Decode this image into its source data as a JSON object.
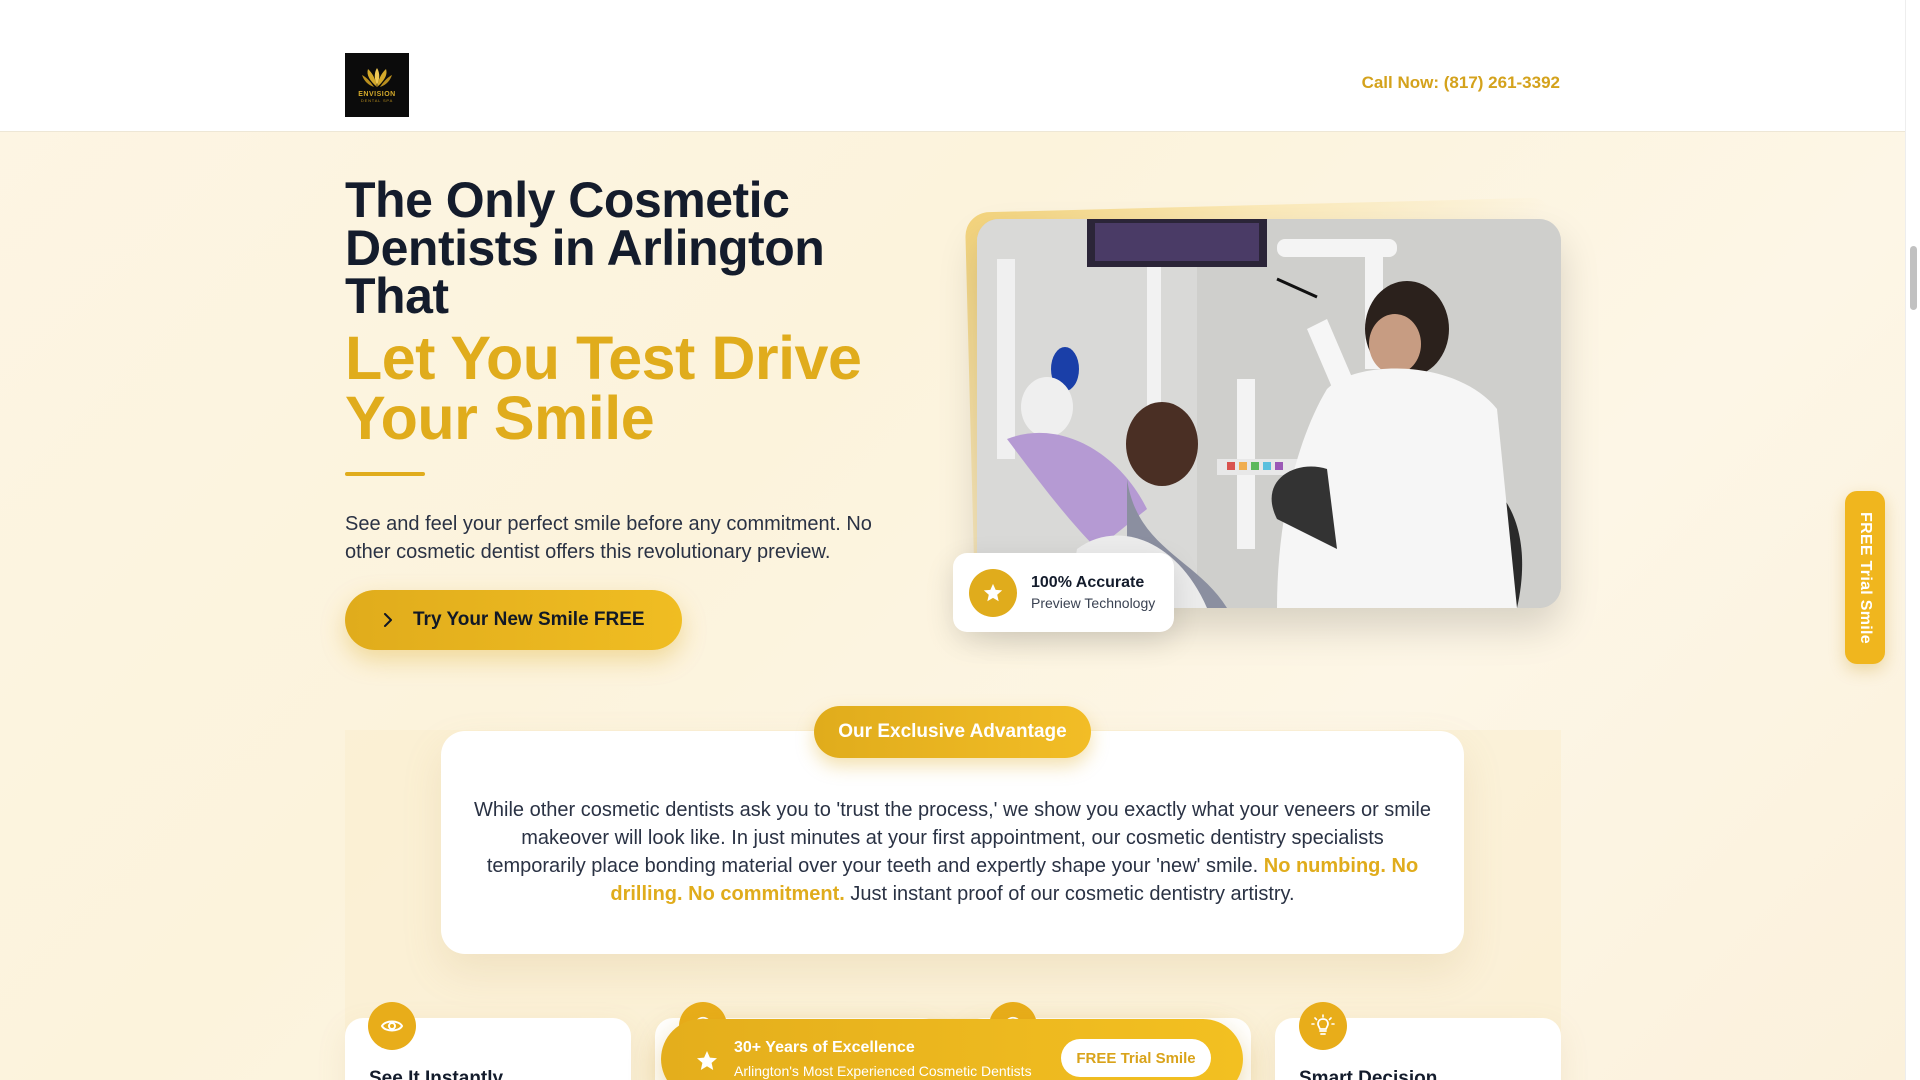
{
  "header": {
    "logo_text": "ENVISION",
    "logo_subtext": "DENTAL SPA",
    "call_label": "Call Now: (817) 261-3392"
  },
  "hero": {
    "title_line1": "The Only Cosmetic",
    "title_line2": "Dentists in Arlington",
    "title_line3": "That",
    "title_gold_line1": "Let You Test Drive",
    "title_gold_line2": "Your Smile",
    "description": "See and feel your perfect smile before any commitment. No other cosmetic dentist offers this revolutionary preview.",
    "cta_label": "Try Your New Smile FREE"
  },
  "badge": {
    "title": "100% Accurate",
    "subtitle": "Preview Technology"
  },
  "side_tab": {
    "label": "FREE Trial Smile"
  },
  "advantage": {
    "pill_label": "Our Exclusive Advantage",
    "text_before": "While other cosmetic dentists ask you to 'trust the process,' we show you exactly what your veneers or smile makeover will look like. In just minutes at your first appointment, our cosmetic dentistry specialists temporarily place bonding material over your teeth and expertly shape your 'new' smile.",
    "highlight": "No numbing. No drilling. No commitment.",
    "text_after": "Just instant proof of our cosmetic dentistry artistry."
  },
  "features": [
    {
      "title": "See It Instantly",
      "icon": "eye-icon"
    },
    {
      "title": "",
      "icon": "chat-icon"
    },
    {
      "title": "",
      "icon": "chat-icon"
    },
    {
      "title": "Smart Decision",
      "icon": "lightbulb-icon"
    }
  ],
  "float_bar": {
    "title": "30+ Years of Excellence",
    "subtitle": "Arlington's Most Experienced Cosmetic Dentists",
    "button_label": "FREE Trial Smile"
  },
  "colors": {
    "gold": "#e0ac1c",
    "dark_navy": "#141c2c",
    "background_cream": "#fdf5e4"
  }
}
